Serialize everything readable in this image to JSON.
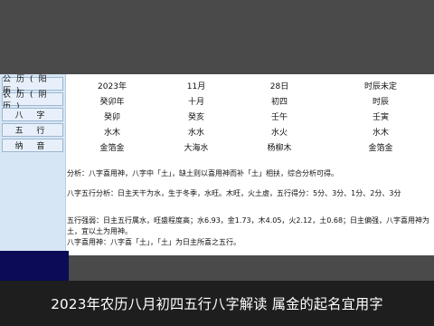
{
  "left_headers": [
    "公历(阳历)",
    "农历(阴历)",
    "八 字",
    "五 行",
    "纳 音"
  ],
  "grid": {
    "columns": [
      [
        "2023年",
        "癸卯年",
        "癸卯",
        "水木",
        "金箔金"
      ],
      [
        "11月",
        "十月",
        "癸亥",
        "水水",
        "大海水"
      ],
      [
        "28日",
        "初四",
        "壬午",
        "水火",
        "杨柳木"
      ],
      [
        "时辰未定",
        "时辰",
        "壬寅",
        "水木",
        "金箔金"
      ]
    ]
  },
  "text": {
    "line1": "分析：八字喜用神，八字中「土」，缺土则以喜用神而补「土」相扶，综合分析可得。",
    "line2": "八字五行分析：日主天干为水，生于冬季，水旺。木旺，火土虚，五行得分：5分、3分、1分、2分、3分",
    "line3": "五行强弱：日主五行属水，旺盛程度高；水6.93，金1.73，木4.05，火2.12，土0.68；日主偏强，八字喜用神为土，宜以土为用神。",
    "line4": "八字喜用神：八字喜「土」，「土」为日主所喜之五行。"
  },
  "caption": "2023年农历八月初四五行八字解读 属金的起名宜用字"
}
